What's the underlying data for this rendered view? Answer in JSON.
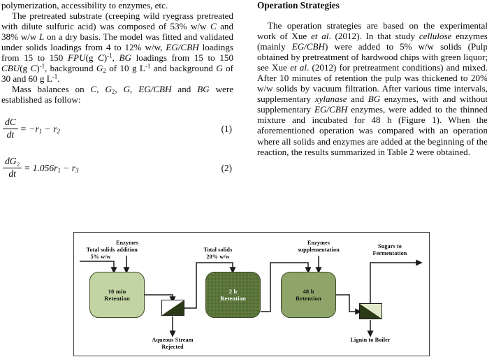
{
  "left_column": {
    "paragraphs": [
      {
        "id": "p1",
        "style": "cont",
        "runs": [
          {
            "t": "polymerization, accessibility to enzymes, etc."
          }
        ]
      },
      {
        "id": "p2",
        "style": "indent",
        "runs": [
          {
            "t": "The pretreated substrate (creeping wild ryegrass pretreated with dilute sulfuric acid) was composed of 53% w/w "
          },
          {
            "t": "C",
            "i": true
          },
          {
            "t": " and 38% w/w "
          },
          {
            "t": "L",
            "i": true
          },
          {
            "t": " on a dry basis. The model was fitted and validated under solids loadings from 4 to 12% w/w, "
          },
          {
            "t": "EG/CBH",
            "i": true
          },
          {
            "t": " loadings from 15 to 150 "
          },
          {
            "t": "FPU",
            "i": true
          },
          {
            "t": "(g ",
            "i": false
          },
          {
            "t": "C",
            "i": true
          },
          {
            "t": ")",
            "i": false
          },
          {
            "t": "-1",
            "sup": true
          },
          {
            "t": ", "
          },
          {
            "t": "BG",
            "i": true
          },
          {
            "t": " loadings from 15 to 150 "
          },
          {
            "t": "CBU",
            "i": true
          },
          {
            "t": "(g "
          },
          {
            "t": "C",
            "i": true
          },
          {
            "t": ")"
          },
          {
            "t": "-1",
            "sup": true
          },
          {
            "t": ", background "
          },
          {
            "t": "G",
            "i": true
          },
          {
            "t": "2",
            "sub": true
          },
          {
            "t": " of 10 g L"
          },
          {
            "t": "-1",
            "sup": true
          },
          {
            "t": " and background "
          },
          {
            "t": "G",
            "i": true
          },
          {
            "t": " of 30 and 60 g L"
          },
          {
            "t": "-1",
            "sup": true
          },
          {
            "t": "."
          }
        ]
      },
      {
        "id": "p3",
        "style": "indent",
        "runs": [
          {
            "t": "Mass balances on "
          },
          {
            "t": "C",
            "i": true
          },
          {
            "t": ", "
          },
          {
            "t": "G",
            "i": true
          },
          {
            "t": "2",
            "sub": true
          },
          {
            "t": ", "
          },
          {
            "t": "G",
            "i": true
          },
          {
            "t": ", "
          },
          {
            "t": "EG/CBH",
            "i": true
          },
          {
            "t": " and "
          },
          {
            "t": "BG",
            "i": true
          },
          {
            "t": " were established as follow:"
          }
        ]
      }
    ],
    "equations": [
      {
        "id": "eq1",
        "num_numerator": "dC",
        "num_denominator": "dt",
        "body_parts": [
          {
            "t": "= −r"
          },
          {
            "t": "1",
            "sub": true
          },
          {
            "t": " − r"
          },
          {
            "t": "2",
            "sub": true
          }
        ],
        "number": "(1)"
      },
      {
        "id": "eq2",
        "num_numerator": "dG₂",
        "num_denominator": "dt",
        "body_parts": [
          {
            "t": "= 1.056r"
          },
          {
            "t": "1",
            "sub": true
          },
          {
            "t": " − r"
          },
          {
            "t": "3",
            "sub": true
          }
        ],
        "number": "(2)"
      }
    ]
  },
  "right_column": {
    "heading": "Operation Strategies",
    "paragraphs": [
      {
        "id": "rp1",
        "style": "indent",
        "runs": [
          {
            "t": "The operation strategies are based on the experimental work of Xue "
          },
          {
            "t": "et al",
            "i": true
          },
          {
            "t": ". (2012). In that study "
          },
          {
            "t": "cellulose",
            "i": true
          },
          {
            "t": " enzymes (mainly "
          },
          {
            "t": "EG/CBH",
            "i": true
          },
          {
            "t": ") were added to 5% w/w solids (Pulp obtained by pretreatment of hardwood chips with green liquor; see Xue "
          },
          {
            "t": "et al",
            "i": true
          },
          {
            "t": ". (2012) for pretreatment conditions) and mixed. After 10 minutes of retention the pulp was thickened to 20% w/w solids by vacuum filtration. After various time intervals, supplementary "
          },
          {
            "t": "xylanase",
            "i": true
          },
          {
            "t": " and "
          },
          {
            "t": "BG",
            "i": true
          },
          {
            "t": " enzymes, with and without supplementary "
          },
          {
            "t": "EG/CBH",
            "i": true
          },
          {
            "t": " enzymes, were added to the thinned mixture and incubated for 48 h (Figure 1). When the aforementioned operation was compared with an operation where all solids and enzymes are added at the beginning of the reaction, the results summarized in Table 2 were obtained."
          }
        ]
      }
    ]
  },
  "figure": {
    "nodes": [
      {
        "id": "n1",
        "line1": "10 min",
        "line2": "Retention",
        "fill": "#c3d4a4"
      },
      {
        "id": "n2",
        "line1": "2 h",
        "line2": "Retention",
        "fill": "#4f6a2c"
      },
      {
        "id": "n3",
        "line1": "48 h",
        "line2": "Retention",
        "fill": "#8ea468"
      }
    ],
    "labels": {
      "total_solids_5": {
        "line1": "Total solids",
        "line2": "5% w/w"
      },
      "enzymes_addition": {
        "line1": "Enzymes",
        "line2": "addition"
      },
      "total_solids_20": {
        "line1": "Total solids",
        "line2": "20% w/w"
      },
      "enzymes_supplementation": {
        "line1": "Enzymes",
        "line2": "supplementation"
      },
      "sugars_to_fermentation": {
        "line1": "Sugars to",
        "line2": "Fermentation"
      },
      "aqueous_stream_rejected": {
        "line1": "Aqueous Stream",
        "line2": "Rejected"
      },
      "lignin_to_boiler": {
        "line1": "Lignin to Boiler",
        "line2": ""
      }
    },
    "colors": {
      "node_light": "#c3d4a4",
      "node_dark": "#4f6a2c",
      "node_mid": "#8ea468",
      "separator_dark": "#2b3a17",
      "separator_light": "#e2eacb",
      "line": "#1b1b1b",
      "frame": "#3a3a3a"
    }
  }
}
